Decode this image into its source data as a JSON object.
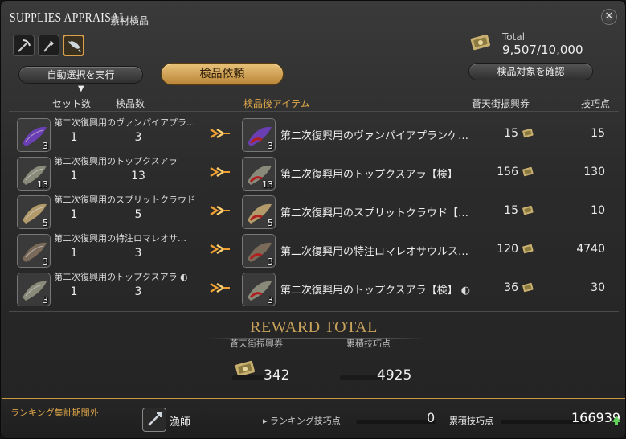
{
  "window": {
    "title_en": "SUPPLIES APPRAISAL",
    "title_jp": "素材検品",
    "close_glyph": "✕"
  },
  "tabs": [
    {
      "icon": "pickaxe-icon"
    },
    {
      "icon": "hatchet-icon"
    },
    {
      "icon": "fishing-icon",
      "active": true
    }
  ],
  "total": {
    "label": "Total",
    "value": "9,507/10,000"
  },
  "buttons": {
    "auto_select": "自動選択を実行",
    "request": "検品依頼",
    "confirm": "検品対象を確認"
  },
  "headers": {
    "sets": "セット数",
    "count": "検品数",
    "result": "検品後アイテム",
    "scrip": "蒼天街振興券",
    "points": "技巧点"
  },
  "rows": [
    {
      "name": "第二次復興用のヴァンパイアプラ…",
      "qty": "3",
      "sets": "1",
      "count": "3",
      "result_name": "第二次復興用のヴァンパイアプランケ…",
      "result_qty": "3",
      "scrip": "15",
      "points": "15",
      "color": "#6a3fb3"
    },
    {
      "name": "第二次復興用のトップクスアラ",
      "qty": "13",
      "sets": "1",
      "count": "13",
      "result_name": "第二次復興用のトップクスアラ【検】",
      "result_qty": "13",
      "scrip": "156",
      "points": "130",
      "color": "#8a8a7a"
    },
    {
      "name": "第二次復興用のスプリットクラウド",
      "qty": "5",
      "sets": "1",
      "count": "5",
      "result_name": "第二次復興用のスプリットクラウド【…",
      "result_qty": "5",
      "scrip": "15",
      "points": "10",
      "color": "#b39a6a"
    },
    {
      "name": "第二次復興用の特注ロマレオサ…",
      "qty": "3",
      "sets": "1",
      "count": "3",
      "result_name": "第二次復興用の特注ロマレオサウルス…",
      "result_qty": "3",
      "scrip": "120",
      "points": "4740",
      "color": "#7a6a5a"
    },
    {
      "name": "第二次復興用のトップクスアラ",
      "qty": "3",
      "sets": "1",
      "count": "3",
      "result_name": "第二次復興用のトップクスアラ【検】",
      "result_qty": "3",
      "scrip": "36",
      "points": "30",
      "color": "#8a8a7a",
      "hq": true
    }
  ],
  "reward": {
    "title": "REWARD TOTAL",
    "scrip_label": "蒼天街振興券",
    "points_label": "累積技巧点",
    "scrip_value": "342",
    "points_value": "4925"
  },
  "footer": {
    "period_label": "ランキング集計期間外",
    "job": "漁師",
    "ranking_label": "ランキング技巧点",
    "ranking_value": "0",
    "accum_label": "累積技巧点",
    "accum_value": "166939"
  },
  "colors": {
    "accent_gold": "#e0a84a",
    "increase_green": "#5fd35a"
  }
}
